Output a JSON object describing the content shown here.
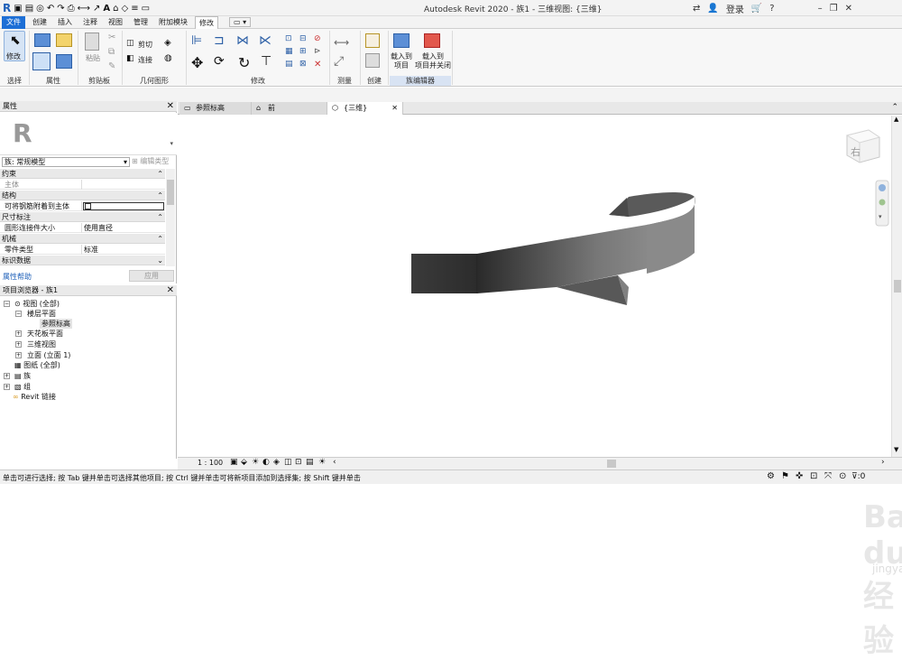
{
  "app": {
    "title": "Autodesk Revit 2020 - 族1 - 三维视图: {三维}",
    "login_label": "登录",
    "help_label": "?"
  },
  "menu": {
    "tabs": [
      "文件",
      "创建",
      "插入",
      "注释",
      "视图",
      "管理",
      "附加模块",
      "修改"
    ],
    "active_tab": "修改"
  },
  "ribbon": {
    "panels": [
      "选择",
      "属性",
      "剪贴板",
      "几何图形",
      "修改",
      "测量",
      "创建",
      "族编辑器"
    ],
    "modify_label": "修改",
    "paste_label": "粘贴",
    "cut_label": "剪切",
    "join_label": "连接",
    "load_into_project": "载入到\n项目",
    "load_into_project_close": "载入到\n项目并关闭"
  },
  "properties": {
    "title": "属性",
    "family_select": "族: 常规模型",
    "edit_type": "编辑类型",
    "sections": [
      {
        "name": "约束",
        "rows": [
          {
            "key": "主体",
            "value": ""
          }
        ]
      },
      {
        "name": "结构",
        "rows": [
          {
            "key": "可将钢筋附着到主体",
            "value": ""
          }
        ]
      },
      {
        "name": "尺寸标注",
        "rows": [
          {
            "key": "圆形连接件大小",
            "value": "使用直径"
          }
        ]
      },
      {
        "name": "机械",
        "rows": [
          {
            "key": "零件类型",
            "value": "标准"
          }
        ]
      },
      {
        "name": "标识数据",
        "rows": []
      }
    ],
    "help_link": "属性帮助",
    "apply": "应用"
  },
  "browser": {
    "title": "项目浏览器 - 族1",
    "items": [
      {
        "label": "视图 (全部)",
        "level": 0
      },
      {
        "label": "楼层平面",
        "level": 1
      },
      {
        "label": "参照标高",
        "level": 2
      },
      {
        "label": "天花板平面",
        "level": 1
      },
      {
        "label": "三维视图",
        "level": 1
      },
      {
        "label": "立面 (立面 1)",
        "level": 1
      },
      {
        "label": "图纸 (全部)",
        "level": 0
      },
      {
        "label": "族",
        "level": 0
      },
      {
        "label": "组",
        "level": 0
      },
      {
        "label": "Revit 链接",
        "level": 0
      }
    ]
  },
  "view_tabs": [
    {
      "label": "参照标高"
    },
    {
      "label": "前"
    },
    {
      "label": "{三维}"
    }
  ],
  "viewcube_label": "右",
  "viewbar": {
    "scale": "1 : 100"
  },
  "status": {
    "text": "单击可进行选择; 按 Tab 键并单击可选择其他项目; 按 Ctrl 键并单击可将新项目添加到选择集; 按 Shift 键并单击",
    "filter_count": ":0"
  },
  "watermark": {
    "main": "Bai du 经验",
    "sub": "jingyan.baidu.com"
  },
  "colors": {
    "file_tab": "#1d6fd6",
    "family_editor_band": "#d8e3f3",
    "shape_dark": "#3a3a3a"
  }
}
